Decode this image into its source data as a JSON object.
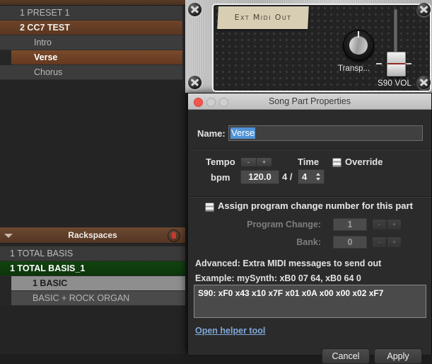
{
  "song_parts": {
    "rows": [
      {
        "label": "1 PRESET 1",
        "type": "song"
      },
      {
        "label": "2 CC7 TEST",
        "type": "song-selected"
      },
      {
        "label": "Intro",
        "type": "part"
      },
      {
        "label": "Verse",
        "type": "part-selected"
      },
      {
        "label": "Chorus",
        "type": "part"
      }
    ]
  },
  "rackspaces": {
    "header_title": "Rackspaces",
    "arrow_icon": "chevron-down-icon",
    "lock_icon": "lock-icon",
    "rows": [
      {
        "label": "1 TOTAL BASIS",
        "type": "rack"
      },
      {
        "label": "1 TOTAL BASIS_1",
        "type": "rack-selected"
      },
      {
        "label": "1  BASIC",
        "type": "variation-selected"
      },
      {
        "label": "BASIC + ROCK ORGAN",
        "type": "variation"
      }
    ]
  },
  "rack_panel": {
    "tape_label": "Ext Midi Out",
    "knob_label": "Transp...",
    "fader_label": "S90 VOL"
  },
  "dialog": {
    "title": "Song Part Properties",
    "name": {
      "label": "Name:",
      "value": "Verse"
    },
    "tempo": {
      "label": "Tempo",
      "bpm_label": "bpm",
      "value": "120.0",
      "minus": "-",
      "plus": "+"
    },
    "time": {
      "label": "Time",
      "numerator": "4 /",
      "denominator": "4"
    },
    "override": {
      "label": "Override",
      "state": "mixed"
    },
    "assign": {
      "label": "Assign program change number for this part",
      "state": "mixed",
      "program_change_label": "Program Change:",
      "program_change_value": "1",
      "bank_label": "Bank:",
      "bank_value": "0",
      "minus": "-",
      "plus": "+"
    },
    "advanced": {
      "heading": "Advanced: Extra MIDI messages to send out",
      "example": "Example: mySynth: xB0 07 64, xB0 64 0",
      "midi_text": "S90: xF0 x43 x10 x7F x01 x0A x00 x00 x02 xF7",
      "helper_link": "Open helper tool"
    },
    "buttons": {
      "cancel": "Cancel",
      "apply": "Apply"
    }
  }
}
